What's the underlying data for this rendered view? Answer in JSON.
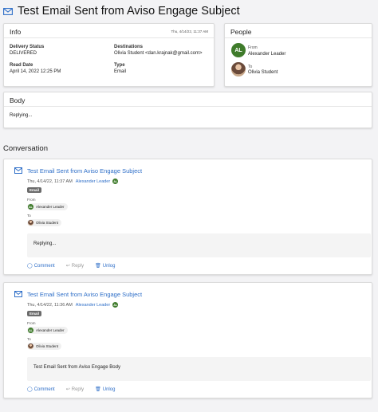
{
  "page": {
    "title": "Test Email Sent from Aviso Engage Subject",
    "title_icon": "envelope-icon"
  },
  "info": {
    "header": "Info",
    "timestamp": "Thu, 4/14/22, 11:37 AM",
    "delivery_status_label": "Delivery Status",
    "delivery_status_value": "DELIVERED",
    "destinations_label": "Destinations",
    "destinations_value": "Olivia Student <dan.krajnak@gmail.com>",
    "read_date_label": "Read Date",
    "read_date_value": "April 14, 2022 12:25 PM",
    "type_label": "Type",
    "type_value": "Email"
  },
  "people": {
    "header": "People",
    "from_label": "From",
    "from_name": "Alexander Leader",
    "from_initials": "AL",
    "to_label": "To",
    "to_name": "Olivia Student"
  },
  "body_card": {
    "header": "Body",
    "text": "Replying..."
  },
  "conversation": {
    "title": "Conversation",
    "messages": [
      {
        "subject": "Test Email Sent from Aviso Engage Subject",
        "timestamp": "Thu, 4/14/22, 11:37 AM",
        "sender": "Alexander Leader",
        "sender_initials": "AL",
        "badge": "Email",
        "from_label": "From",
        "from_name": "Alexander Leader",
        "to_label": "To",
        "to_name": "Olivia Student",
        "body": "Replying...",
        "comment": "Comment",
        "reply": "Reply",
        "unlog": "Unlog"
      },
      {
        "subject": "Test Email Sent from Aviso Engage Subject",
        "timestamp": "Thu, 4/14/22, 11:36 AM",
        "sender": "Alexander Leader",
        "sender_initials": "AL",
        "badge": "Email",
        "from_label": "From",
        "from_name": "Alexander Leader",
        "to_label": "To",
        "to_name": "Olivia Student",
        "body": "Test Email Sent from Aviso Engage Body",
        "comment": "Comment",
        "reply": "Reply",
        "unlog": "Unlog"
      }
    ]
  },
  "colors": {
    "link": "#2f6fc8",
    "avatar_green": "#3f7b2b",
    "badge": "#6b6b6b"
  }
}
